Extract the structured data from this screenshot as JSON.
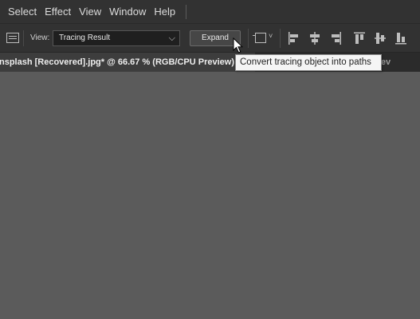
{
  "menubar": {
    "items": [
      "Select",
      "Effect",
      "View",
      "Window",
      "Help"
    ]
  },
  "controlbar": {
    "view_label": "View:",
    "view_value": "Tracing Result",
    "expand_label": "Expand"
  },
  "icons": {
    "panel": "panel-toggle-icon",
    "select_chevron": "chevron-down-icon",
    "artboard": "artboard-icon",
    "align": [
      "align-left-icon",
      "align-horizontal-center-icon",
      "align-right-icon",
      "align-top-icon",
      "align-vertical-center-icon",
      "align-bottom-icon"
    ],
    "cursor": "mouse-pointer-icon"
  },
  "tabs": {
    "active": "nsplash [Recovered].jpg* @ 66.67 % (RGB/CPU Preview)",
    "second": "CPU Prev"
  },
  "tooltip": {
    "text": "Convert tracing object into paths"
  },
  "colors": {
    "chrome": "#323232",
    "canvas": "#5b5b5b",
    "tooltip_bg": "#f5f5f5"
  }
}
